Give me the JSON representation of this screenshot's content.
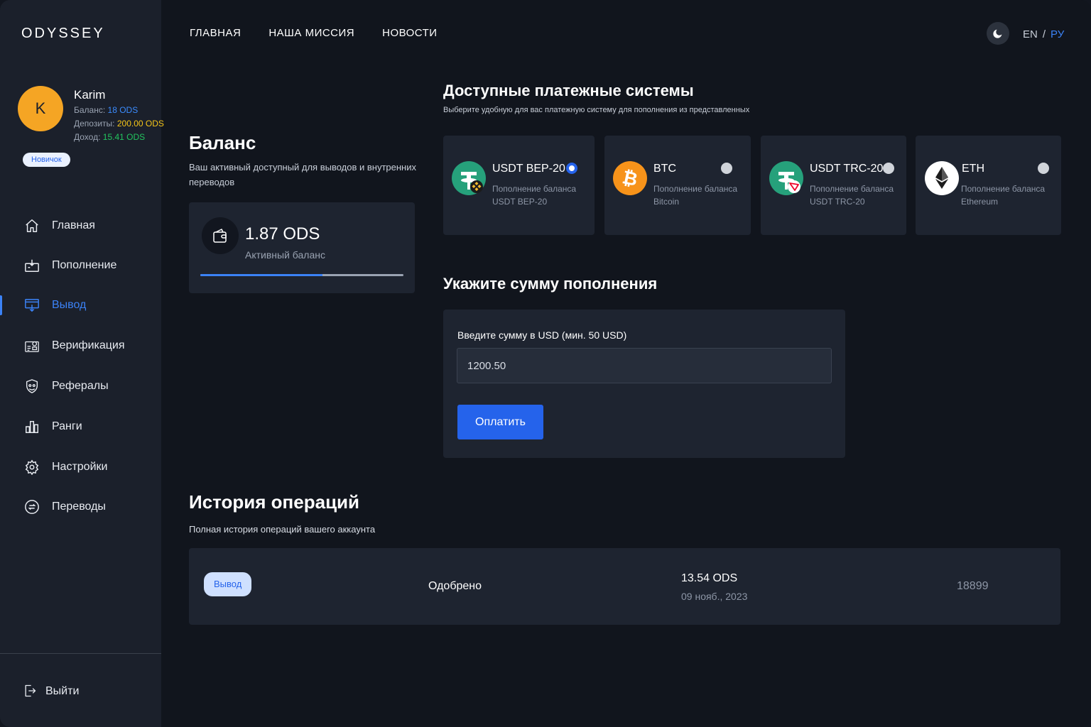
{
  "brand": {
    "logo": "ODYSSEY"
  },
  "user": {
    "initial": "K",
    "name": "Karim",
    "balance_label": "Баланс:",
    "balance_value": "18 ODS",
    "deposits_label": "Депозиты:",
    "deposits_value": "200.00 ODS",
    "income_label": "Доход:",
    "income_value": "15.41 ODS",
    "rank": "Новичок"
  },
  "sidebar": {
    "items": [
      {
        "label": "Главная",
        "icon": "home-icon"
      },
      {
        "label": "Пополнение",
        "icon": "deposit-icon"
      },
      {
        "label": "Вывод",
        "icon": "withdraw-icon",
        "active": true
      },
      {
        "label": "Верификация",
        "icon": "id-card-icon"
      },
      {
        "label": "Рефералы",
        "icon": "referral-icon"
      },
      {
        "label": "Ранги",
        "icon": "ranks-icon"
      },
      {
        "label": "Настройки",
        "icon": "gear-icon"
      },
      {
        "label": "Переводы",
        "icon": "transfer-icon"
      }
    ],
    "logout": "Выйти"
  },
  "topnav": {
    "links": [
      "ГЛАВНАЯ",
      "НАША МИССИЯ",
      "НОВОСТИ"
    ],
    "lang_en": "EN",
    "lang_sep": "/",
    "lang_ru": "РУ"
  },
  "balance": {
    "title": "Баланс",
    "subtitle": "Ваш активный доступный для выводов и внутренних переводов",
    "amount": "1.87 ODS",
    "caption": "Активный баланс",
    "progress_fraction": 0.6
  },
  "payment_systems": {
    "title": "Доступные платежные системы",
    "subtitle": "Выберите удобную для вас платежную систему для пополнения из представленных",
    "items": [
      {
        "name": "USDT BEP-20",
        "desc1": "Пополнение баланса",
        "desc2": "USDT BEP-20",
        "selected": true
      },
      {
        "name": "BTC",
        "desc1": "Пополнение баланса",
        "desc2": "Bitcoin",
        "selected": false
      },
      {
        "name": "USDT TRC-20",
        "desc1": "Пополнение баланса",
        "desc2": "USDT TRC-20",
        "selected": false
      },
      {
        "name": "ETH",
        "desc1": "Пополнение баланса",
        "desc2": "Ethereum",
        "selected": false
      }
    ]
  },
  "amount_form": {
    "title": "Укажите сумму пополнения",
    "label": "Введите сумму в USD (мин. 50 USD)",
    "value": "1200.50",
    "pay_button": "Оплатить"
  },
  "history": {
    "title": "История операций",
    "subtitle": "Полная история операций вашего аккаунта",
    "rows": [
      {
        "type": "Вывод",
        "status": "Одобрено",
        "amount": "13.54 ODS",
        "date": "09 нояб., 2023",
        "id": "18899"
      }
    ]
  },
  "colors": {
    "accent": "#3b82f6",
    "button": "#2563eb",
    "avatar": "#f5a524",
    "balance_blue": "#3b8cff",
    "deposits_yellow": "#f5c518",
    "income_green": "#22c55e"
  }
}
